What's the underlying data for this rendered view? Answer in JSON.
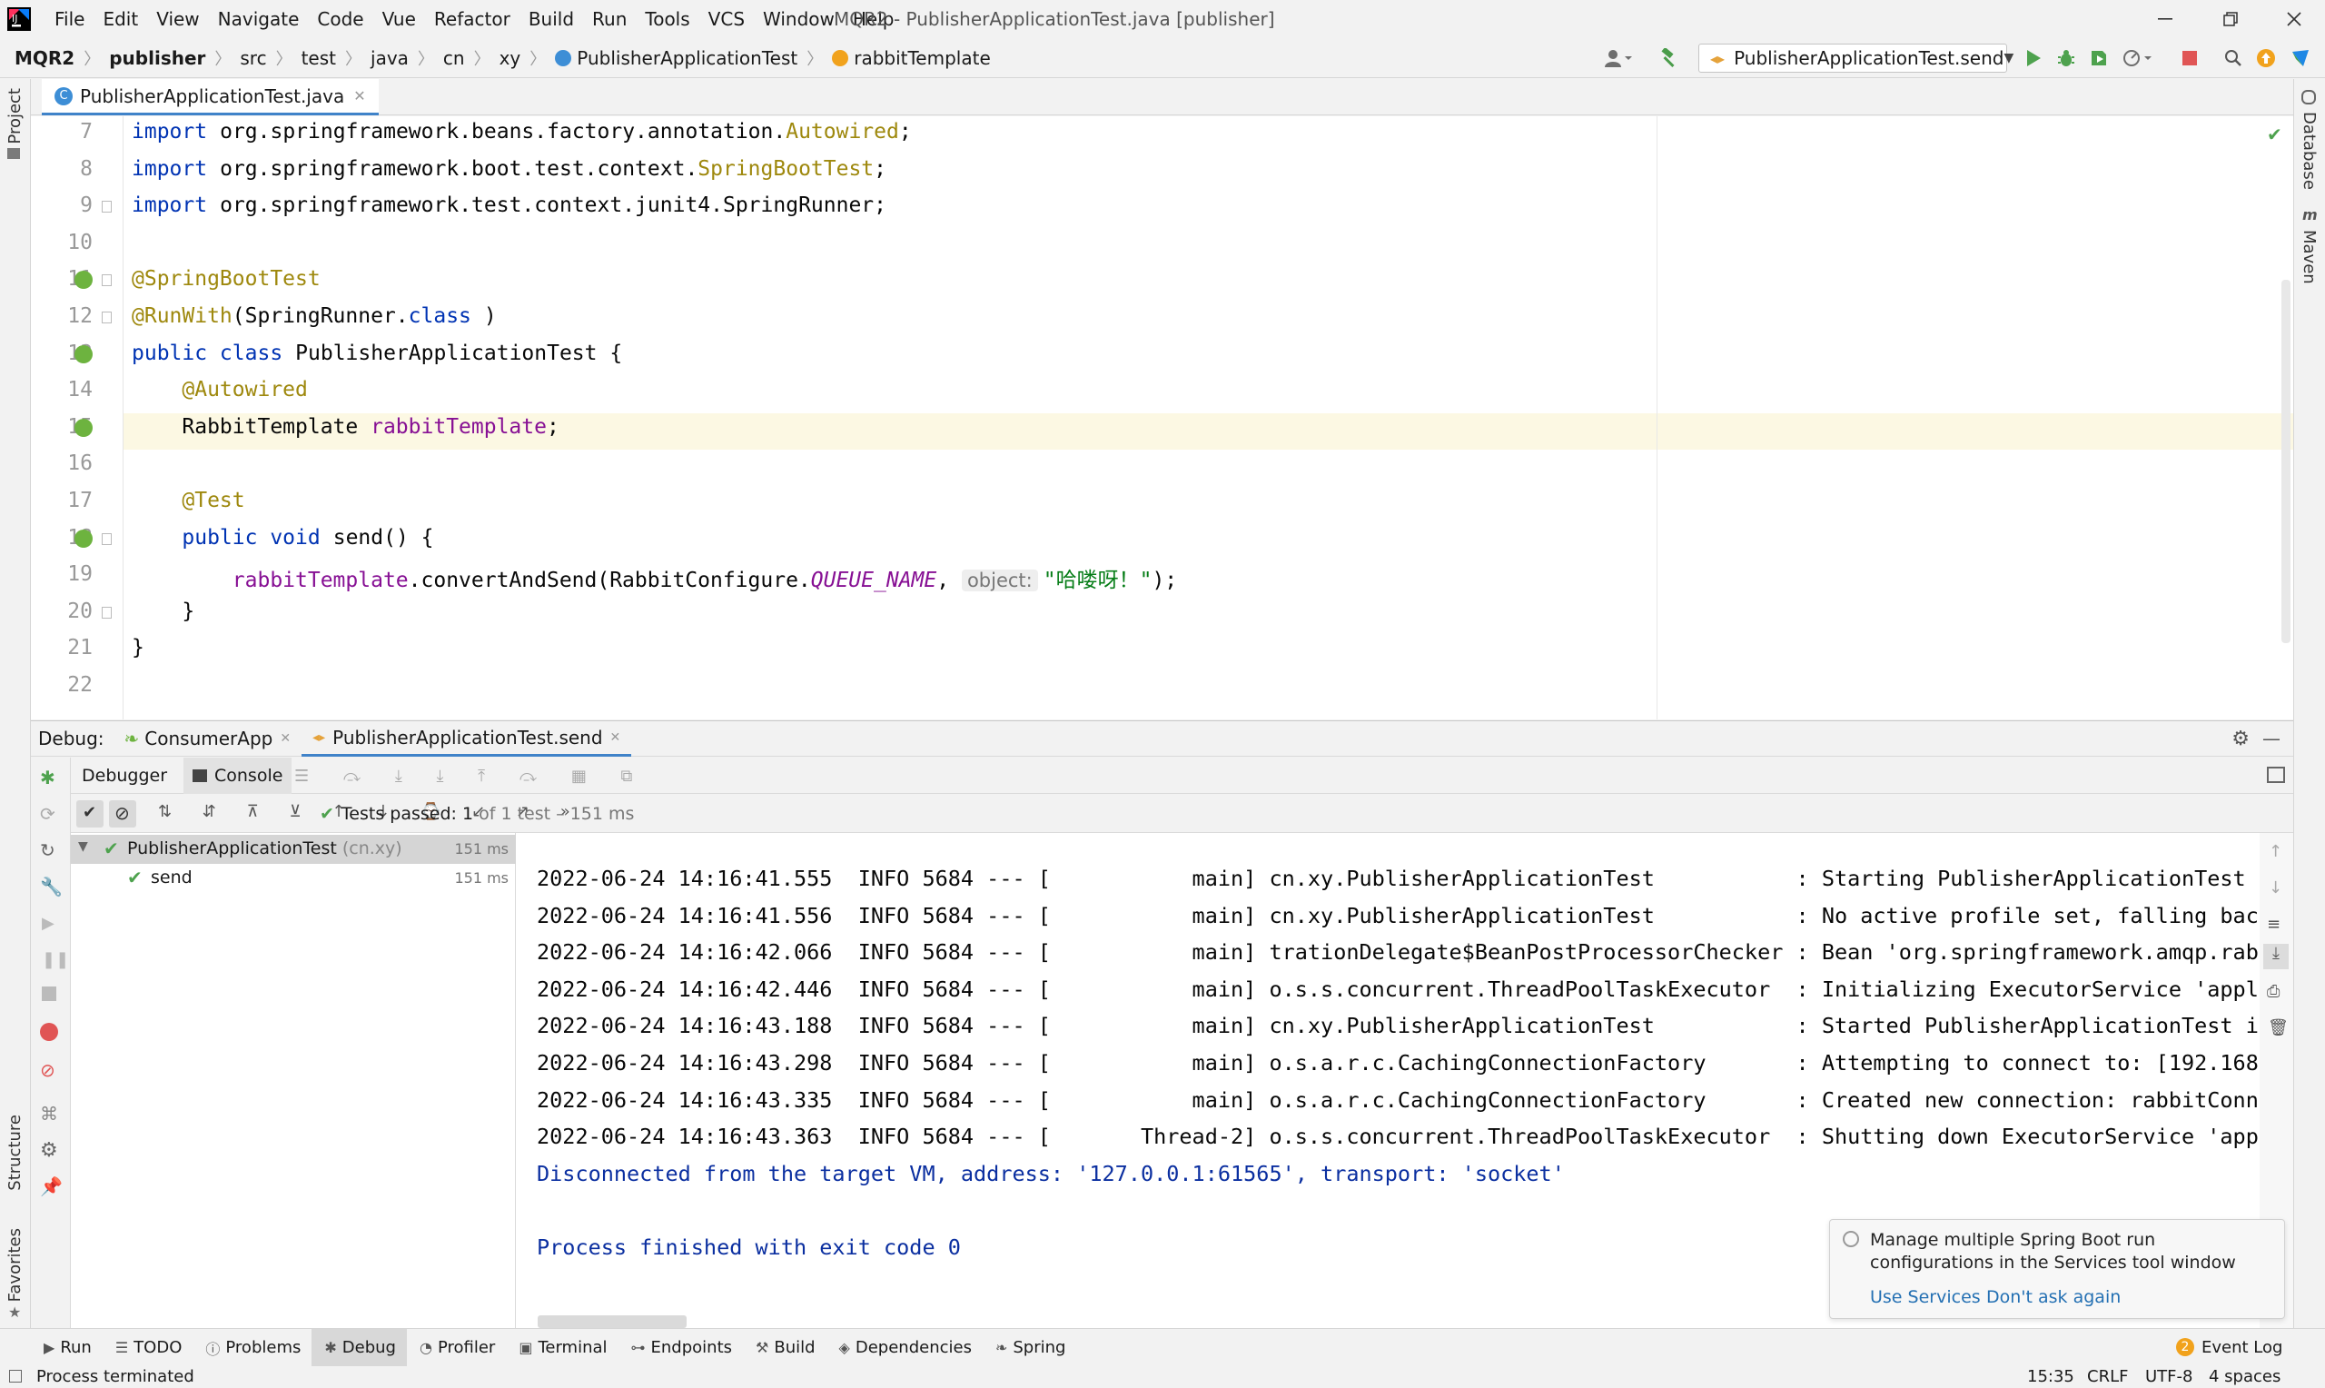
{
  "menu": [
    "File",
    "Edit",
    "View",
    "Navigate",
    "Code",
    "Vue",
    "Refactor",
    "Build",
    "Run",
    "Tools",
    "VCS",
    "Window",
    "Help"
  ],
  "window_title": "MQR2 - PublisherApplicationTest.java [publisher]",
  "breadcrumbs": [
    "MQR2",
    "publisher",
    "src",
    "test",
    "java",
    "cn",
    "xy",
    "PublisherApplicationTest",
    "rabbitTemplate"
  ],
  "run_config": "PublisherApplicationTest.send",
  "editor_tab": "PublisherApplicationTest.java",
  "left_strip": {
    "project": "Project",
    "structure": "Structure",
    "favorites": "Favorites"
  },
  "right_strip": {
    "database": "Database",
    "maven": "Maven"
  },
  "code_lines": [
    {
      "num": "7",
      "tokens": [
        [
          "kw",
          "import"
        ],
        [
          "",
          "org.springframework.beans.factory.annotation."
        ],
        [
          "ann",
          "Autowired"
        ],
        [
          "",
          ";"
        ]
      ]
    },
    {
      "num": "8",
      "tokens": [
        [
          "kw",
          "import"
        ],
        [
          "",
          "org.springframework.boot.test.context."
        ],
        [
          "ann",
          "SpringBootTest"
        ],
        [
          "",
          ";"
        ]
      ]
    },
    {
      "num": "9",
      "tokens": [
        [
          "kw",
          "import"
        ],
        [
          "",
          "org.springframework.test.context.junit4.SpringRunner;"
        ]
      ]
    },
    {
      "num": "10",
      "tokens": []
    },
    {
      "num": "11",
      "tokens": [
        [
          "ann",
          "@SpringBootTest"
        ]
      ]
    },
    {
      "num": "12",
      "tokens": [
        [
          "ann",
          "@RunWith"
        ],
        [
          "",
          "(SpringRunner."
        ],
        [
          "kw",
          "class"
        ],
        [
          "",
          ")"
        ]
      ]
    },
    {
      "num": "13",
      "tokens": [
        [
          "kw",
          "public class"
        ],
        [
          "",
          "PublisherApplicationTest {"
        ]
      ]
    },
    {
      "num": "14",
      "tokens": [
        [
          "",
          "    "
        ],
        [
          "ann",
          "@Autowired"
        ]
      ]
    },
    {
      "num": "15",
      "tokens": [
        [
          "",
          "    RabbitTemplate "
        ],
        [
          "fld",
          "rabbitTemplate"
        ],
        [
          "",
          ";"
        ]
      ]
    },
    {
      "num": "16",
      "tokens": []
    },
    {
      "num": "17",
      "tokens": [
        [
          "",
          "    "
        ],
        [
          "ann",
          "@Test"
        ]
      ]
    },
    {
      "num": "18",
      "tokens": [
        [
          "",
          "    "
        ],
        [
          "kw",
          "public void"
        ],
        [
          "",
          "send() {"
        ]
      ]
    },
    {
      "num": "19",
      "tokens": [
        [
          "",
          "        "
        ],
        [
          "fld",
          "rabbitTemplate"
        ],
        [
          "",
          ".convertAndSend(RabbitConfigure."
        ],
        [
          "sfld",
          "QUEUE_NAME"
        ],
        [
          "",
          ", "
        ],
        [
          "hint",
          "object:"
        ],
        [
          "str",
          "\"哈喽呀！\""
        ],
        [
          "",
          ");"
        ]
      ]
    },
    {
      "num": "20",
      "tokens": [
        [
          "",
          "    }"
        ]
      ]
    },
    {
      "num": "21",
      "tokens": [
        [
          "",
          "}"
        ]
      ]
    },
    {
      "num": "22",
      "tokens": []
    }
  ],
  "debug": {
    "label": "Debug:",
    "tabs": [
      "ConsumerApp",
      "PublisherApplicationTest.send"
    ],
    "subtabs": [
      "Debugger",
      "Console"
    ]
  },
  "tests": {
    "status_prefix": "Tests passed:",
    "status_count": "1",
    "status_suffix": "of 1 test – 151 ms",
    "tree": [
      {
        "label": "PublisherApplicationTest",
        "pkg": "(cn.xy)",
        "time": "151 ms"
      },
      {
        "label": "send",
        "pkg": "",
        "time": "151 ms"
      }
    ]
  },
  "console_lines": [
    "2022-06-24 14:16:41.555  INFO 5684 --- [           main] cn.xy.PublisherApplicationTest           : Starting PublisherApplicationTest on",
    "2022-06-24 14:16:41.556  INFO 5684 --- [           main] cn.xy.PublisherApplicationTest           : No active profile set, falling back",
    "2022-06-24 14:16:42.066  INFO 5684 --- [           main] trationDelegate$BeanPostProcessorChecker : Bean 'org.springframework.amqp.rabbi",
    "2022-06-24 14:16:42.446  INFO 5684 --- [           main] o.s.s.concurrent.ThreadPoolTaskExecutor  : Initializing ExecutorService 'applic",
    "2022-06-24 14:16:43.188  INFO 5684 --- [           main] cn.xy.PublisherApplicationTest           : Started PublisherApplicationTest in",
    "2022-06-24 14:16:43.298  INFO 5684 --- [           main] o.s.a.r.c.CachingConnectionFactory       : Attempting to connect to: [192.168.1",
    "2022-06-24 14:16:43.335  INFO 5684 --- [           main] o.s.a.r.c.CachingConnectionFactory       : Created new connection: rabbitConne",
    "2022-06-24 14:16:43.363  INFO 5684 --- [       Thread-2] o.s.s.concurrent.ThreadPoolTaskExecutor  : Shutting down ExecutorService 'appl"
  ],
  "console_disconnect": "Disconnected from the target VM, address: '127.0.0.1:61565', transport: 'socket'",
  "console_exit": "Process finished with exit code 0",
  "popup": {
    "message_line1": "Manage multiple Spring Boot run",
    "message_line2": "configurations in the Services tool window",
    "action1": "Use Services",
    "action2": "Don't ask again"
  },
  "bottom_tabs": [
    "Run",
    "TODO",
    "Problems",
    "Debug",
    "Profiler",
    "Terminal",
    "Endpoints",
    "Build",
    "Dependencies",
    "Spring"
  ],
  "event_log": {
    "count": "2",
    "label": "Event Log"
  },
  "status": {
    "message": "Process terminated",
    "position": "15:35",
    "line_sep": "CRLF",
    "encoding": "UTF-8",
    "indent": "4 spaces"
  },
  "colors": {
    "accent": "#4083c9",
    "pass_green": "#5aa15a",
    "stop_red": "#e05555"
  }
}
